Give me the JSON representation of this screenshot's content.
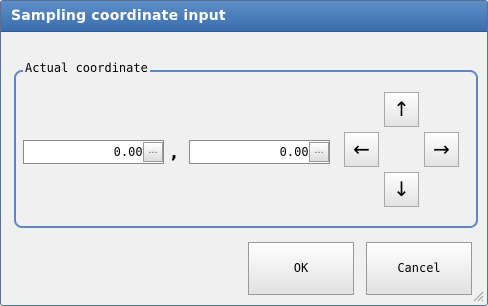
{
  "dialog": {
    "title": "Sampling coordinate input"
  },
  "group": {
    "label": "Actual coordinate"
  },
  "coords": {
    "x_value": "0.0000",
    "y_value": "0.0000",
    "ellipsis": "...",
    "separator": ","
  },
  "arrows": {
    "up": "↑",
    "left": "←",
    "right": "→",
    "down": "↓"
  },
  "buttons": {
    "ok": "OK",
    "cancel": "Cancel"
  },
  "icons": {
    "up": "arrow-up-icon",
    "down": "arrow-down-icon",
    "left": "arrow-left-icon",
    "right": "arrow-right-icon",
    "resize": "resize-grip-icon"
  },
  "colors": {
    "title_bar": "#4a7dbd",
    "group_border": "#5f86c4"
  }
}
